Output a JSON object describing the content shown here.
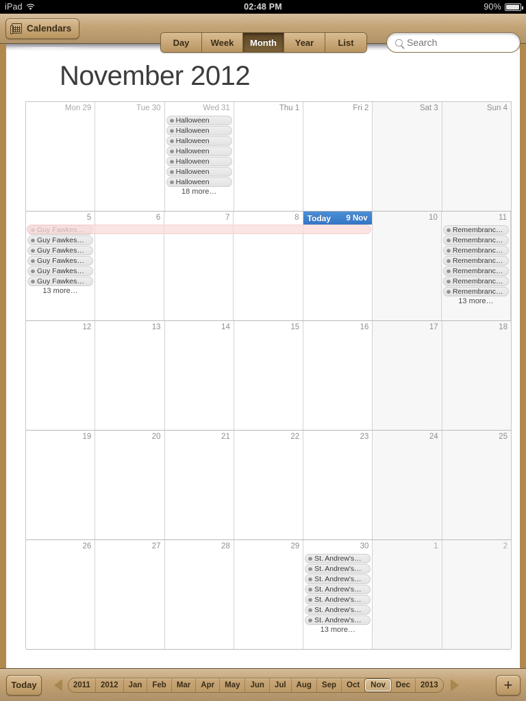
{
  "status_bar": {
    "carrier": "iPad",
    "wifi_icon": "wifi-icon",
    "time": "02:48 PM",
    "battery_percent": "90%",
    "battery_icon": "battery-icon"
  },
  "toolbar": {
    "calendars_label": "Calendars",
    "calendars_icon": "calendar-stack-icon",
    "views": [
      {
        "label": "Day",
        "active": false
      },
      {
        "label": "Week",
        "active": false
      },
      {
        "label": "Month",
        "active": true
      },
      {
        "label": "Year",
        "active": false
      },
      {
        "label": "List",
        "active": false
      }
    ],
    "search_placeholder": "Search",
    "search_value": "",
    "search_icon": "search-icon"
  },
  "page_title": "November 2012",
  "calendar": {
    "weekday_headers": [
      "Mon 29",
      "Tue 30",
      "Wed 31",
      "Thu 1",
      "Fri 2",
      "Sat 3",
      "Sun 4"
    ],
    "more_suffix": "more…",
    "weeks": [
      {
        "days": [
          {
            "header": "Mon 29",
            "num": "29",
            "dim": true,
            "weekend": false,
            "events": [],
            "more": ""
          },
          {
            "header": "Tue 30",
            "num": "30",
            "dim": true,
            "weekend": false,
            "events": [],
            "more": ""
          },
          {
            "header": "Wed 31",
            "num": "31",
            "dim": true,
            "weekend": false,
            "events": [
              "Halloween",
              "Halloween",
              "Halloween",
              "Halloween",
              "Halloween",
              "Halloween",
              "Halloween"
            ],
            "more": "18 more…"
          },
          {
            "header": "Thu 1",
            "num": "1",
            "dim": false,
            "weekend": false,
            "events": [],
            "more": ""
          },
          {
            "header": "Fri 2",
            "num": "2",
            "dim": false,
            "weekend": false,
            "events": [],
            "more": ""
          },
          {
            "header": "Sat 3",
            "num": "3",
            "dim": false,
            "weekend": true,
            "events": [],
            "more": ""
          },
          {
            "header": "Sun 4",
            "num": "4",
            "dim": false,
            "weekend": true,
            "events": [],
            "more": ""
          }
        ]
      },
      {
        "days": [
          {
            "num": "5",
            "dim": false,
            "weekend": false,
            "events": [
              "Guy Fawkes…",
              "Guy Fawkes…",
              "Guy Fawkes…",
              "Guy Fawkes…",
              "Guy Fawkes…",
              "Guy Fawkes…"
            ],
            "more": "13 more…"
          },
          {
            "num": "6",
            "dim": false,
            "weekend": false,
            "events": [],
            "more": ""
          },
          {
            "num": "7",
            "dim": false,
            "weekend": false,
            "events": [],
            "more": ""
          },
          {
            "num": "8",
            "dim": false,
            "weekend": false,
            "events": [],
            "more": ""
          },
          {
            "num": "9",
            "dim": false,
            "weekend": false,
            "today": true,
            "today_label": "Today",
            "today_date": "9 Nov",
            "events": [],
            "more": ""
          },
          {
            "num": "10",
            "dim": false,
            "weekend": true,
            "events": [],
            "more": ""
          },
          {
            "num": "11",
            "dim": false,
            "weekend": true,
            "events": [
              "Remembranc…",
              "Remembranc…",
              "Remembranc…",
              "Remembranc…",
              "Remembranc…",
              "Remembranc…",
              "Remembranc…"
            ],
            "more": "13 more…"
          }
        ]
      },
      {
        "days": [
          {
            "num": "12",
            "dim": false,
            "weekend": false,
            "events": [],
            "more": ""
          },
          {
            "num": "13",
            "dim": false,
            "weekend": false,
            "events": [],
            "more": ""
          },
          {
            "num": "14",
            "dim": false,
            "weekend": false,
            "events": [],
            "more": ""
          },
          {
            "num": "15",
            "dim": false,
            "weekend": false,
            "events": [],
            "more": ""
          },
          {
            "num": "16",
            "dim": false,
            "weekend": false,
            "events": [],
            "more": ""
          },
          {
            "num": "17",
            "dim": false,
            "weekend": true,
            "events": [],
            "more": ""
          },
          {
            "num": "18",
            "dim": false,
            "weekend": true,
            "events": [],
            "more": ""
          }
        ]
      },
      {
        "days": [
          {
            "num": "19",
            "dim": false,
            "weekend": false,
            "events": [],
            "more": ""
          },
          {
            "num": "20",
            "dim": false,
            "weekend": false,
            "events": [],
            "more": ""
          },
          {
            "num": "21",
            "dim": false,
            "weekend": false,
            "events": [],
            "more": ""
          },
          {
            "num": "22",
            "dim": false,
            "weekend": false,
            "events": [],
            "more": ""
          },
          {
            "num": "23",
            "dim": false,
            "weekend": false,
            "events": [],
            "more": ""
          },
          {
            "num": "24",
            "dim": false,
            "weekend": true,
            "events": [],
            "more": ""
          },
          {
            "num": "25",
            "dim": false,
            "weekend": true,
            "events": [],
            "more": ""
          }
        ]
      },
      {
        "days": [
          {
            "num": "26",
            "dim": false,
            "weekend": false,
            "events": [],
            "more": ""
          },
          {
            "num": "27",
            "dim": false,
            "weekend": false,
            "events": [],
            "more": ""
          },
          {
            "num": "28",
            "dim": false,
            "weekend": false,
            "events": [],
            "more": ""
          },
          {
            "num": "29",
            "dim": false,
            "weekend": false,
            "events": [],
            "more": ""
          },
          {
            "num": "30",
            "dim": false,
            "weekend": false,
            "events": [
              "St. Andrew's…",
              "St. Andrew's…",
              "St. Andrew's…",
              "St. Andrew's…",
              "St. Andrew's…",
              "St. Andrew's…",
              "St. Andrew's…"
            ],
            "more": "13 more…"
          },
          {
            "num": "1",
            "dim": true,
            "weekend": true,
            "events": [],
            "more": ""
          },
          {
            "num": "2",
            "dim": true,
            "weekend": true,
            "events": [],
            "more": ""
          }
        ]
      }
    ]
  },
  "bottom_bar": {
    "today_label": "Today",
    "prev_icon": "triangle-left-icon",
    "next_icon": "triangle-right-icon",
    "add_label": "+",
    "months": [
      {
        "label": "2011",
        "selected": false
      },
      {
        "label": "2012",
        "selected": false
      },
      {
        "label": "Jan",
        "selected": false
      },
      {
        "label": "Feb",
        "selected": false
      },
      {
        "label": "Mar",
        "selected": false
      },
      {
        "label": "Apr",
        "selected": false
      },
      {
        "label": "May",
        "selected": false
      },
      {
        "label": "Jun",
        "selected": false
      },
      {
        "label": "Jul",
        "selected": false
      },
      {
        "label": "Aug",
        "selected": false
      },
      {
        "label": "Sep",
        "selected": false
      },
      {
        "label": "Oct",
        "selected": false
      },
      {
        "label": "Nov",
        "selected": true
      },
      {
        "label": "Dec",
        "selected": false
      },
      {
        "label": "2013",
        "selected": false
      }
    ]
  },
  "colors": {
    "toolbar": "#c4a374",
    "today_blue": "#3f82ce",
    "pill_gray": "#e3e3e3",
    "paper": "#ffffff",
    "multiday_pink": "#fadbd9"
  }
}
